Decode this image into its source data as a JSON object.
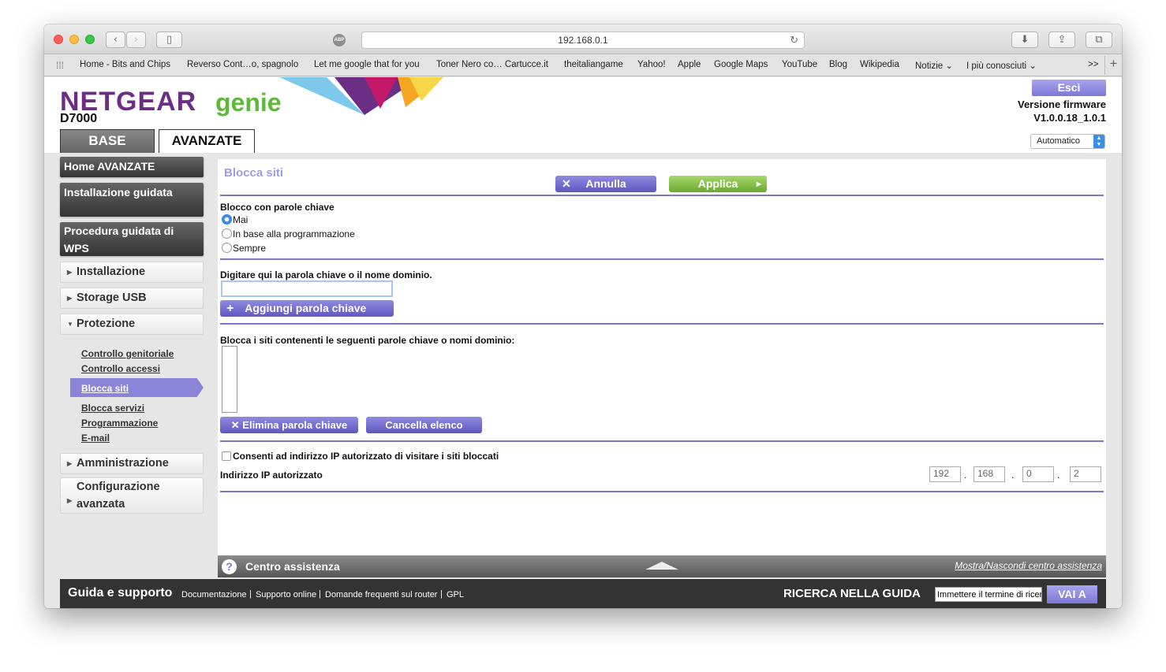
{
  "browser": {
    "url": "192.168.0.1",
    "bookmarks": [
      "Home - Bits and Chips",
      "Reverso Cont…o, spagnolo",
      "Let me google that for you",
      "Toner Nero co… Cartucce.it",
      "theitaliangame",
      "Yahoo!",
      "Apple",
      "Google Maps",
      "YouTube",
      "Blog",
      "Wikipedia",
      "Notizie ⌄",
      "I più conosciuti ⌄"
    ],
    "more": ">>",
    "abp": "ABP"
  },
  "header": {
    "brand": "NETGEAR",
    "product": "genie",
    "model": "D7000",
    "tab_base": "BASE",
    "tab_advanced": "AVANZATE",
    "logout": "Esci",
    "fw_label": "Versione firmware",
    "fw_version": "V1.0.0.18_1.0.1",
    "language": "Automatico"
  },
  "sidebar": {
    "home": "Home AVANZATE",
    "setup_wizard": "Installazione guidata",
    "wps": "Procedura guidata di WPS",
    "installazione": "Installazione",
    "usb": "Storage USB",
    "protezione": "Protezione",
    "subitems": [
      "Controllo genitoriale",
      "Controllo accessi",
      "Blocca siti",
      "Blocca servizi",
      "Programmazione",
      "E-mail"
    ],
    "admin": "Amministrazione",
    "advanced": "Configurazione avanzata"
  },
  "main": {
    "title": "Blocca siti",
    "cancel": "Annulla",
    "apply": "Applica",
    "keyword_block_label": "Blocco con parole chiave",
    "options": [
      "Mai",
      "In base alla programmazione",
      "Sempre"
    ],
    "selected_option": "Mai",
    "keyword_input_label": "Digitare qui la parola chiave o il nome dominio.",
    "keyword_input_value": "",
    "add_keyword": "Aggiungi parola chiave",
    "list_label": "Blocca i siti contenenti le seguenti parole chiave o nomi dominio:",
    "delete_keyword": "Elimina parola chiave",
    "clear_list": "Cancella elenco",
    "allow_trusted_label": "Consenti ad indirizzo IP autorizzato di visitare i siti bloccati",
    "trusted_ip_label": "Indirizzo IP autorizzato",
    "ip": [
      "192",
      "168",
      "0",
      "2"
    ]
  },
  "help": {
    "title": "Centro assistenza",
    "toggle": "Mostra/Nascondi centro assistenza"
  },
  "footer": {
    "title": "Guida e supporto",
    "links": [
      "Documentazione",
      "Supporto online",
      "Domande frequenti sul router",
      "GPL"
    ],
    "search_label": "RICERCA NELLA GUIDA",
    "search_placeholder": "Immettere il termine di ricerca",
    "go": "VAI A"
  },
  "colors": {
    "accent": "#7d77d8",
    "green": "#6aaa2f",
    "netgear_purple": "#6b2e84"
  }
}
